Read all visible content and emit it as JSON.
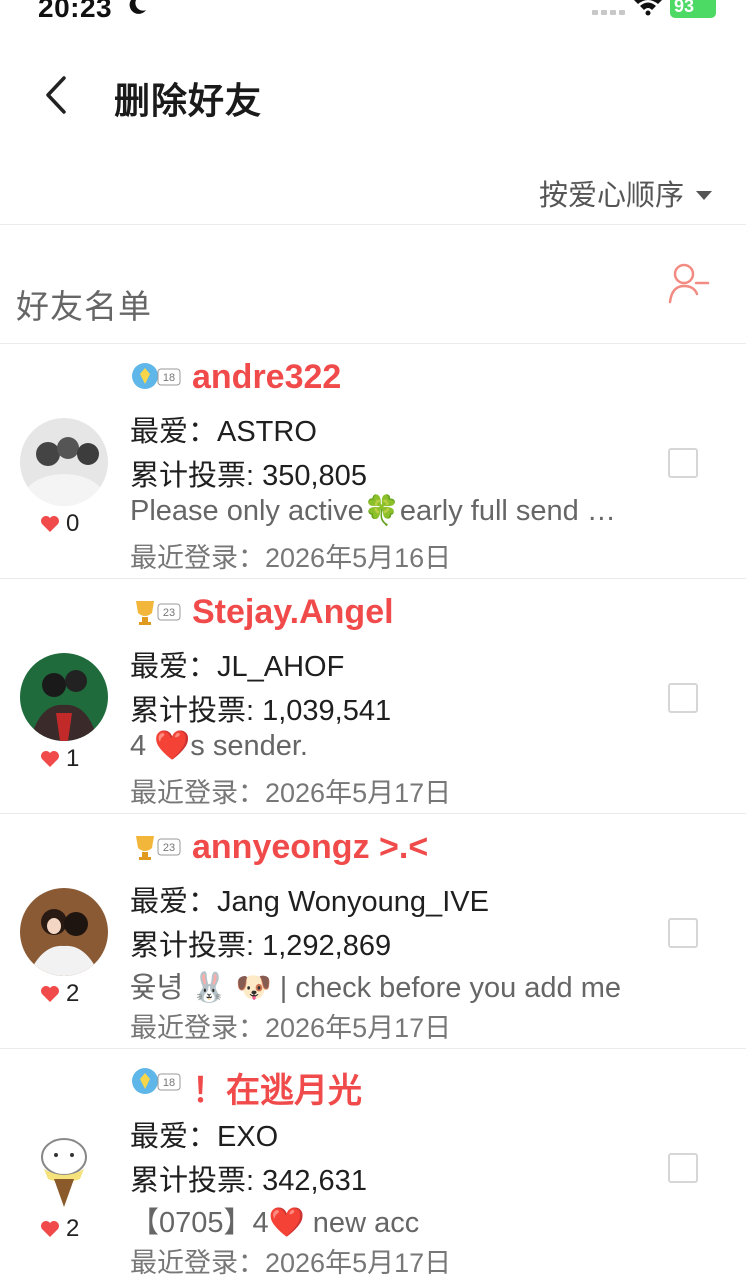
{
  "status_bar": {
    "time": "20:23",
    "battery": "93"
  },
  "header": {
    "title": "删除好友",
    "back_icon": "chevron-left-icon"
  },
  "sort": {
    "label": "按爱心顺序"
  },
  "section": {
    "title": "好友名单",
    "action_icon": "remove-user-icon"
  },
  "colors": {
    "accent": "#f04a4a",
    "battery": "#4cd964"
  },
  "friends": [
    {
      "badge_level": "18",
      "nickname": "andre322",
      "favorite": "最爱：ASTRO",
      "votes": "累计投票: 350,805",
      "bio": "Please only active🍀early full send gifts",
      "login": "最近登录：2026年5月16日",
      "hearts": "0"
    },
    {
      "badge_level": "23",
      "nickname": "Stejay.Angel",
      "favorite": "最爱：JL_AHOF",
      "votes": "累计投票: 1,039,541",
      "bio": "4 ❤️s sender.",
      "login": "最近登录：2026年5月17日",
      "hearts": "1"
    },
    {
      "badge_level": "23",
      "nickname": "annyeongz >.<",
      "favorite": "最爱：Jang Wonyoung_IVE",
      "votes": "累计投票: 1,292,869",
      "bio": "윶녕 🐰 🐶 | check before you add me",
      "login": "最近登录：2026年5月17日",
      "hearts": "2"
    },
    {
      "badge_level": "18",
      "nickname": "！在逃月光",
      "favorite": "最爱：EXO",
      "votes": "累计投票: 342,631",
      "bio": "【0705】4❤️ new acc",
      "login": "最近登录：2026年5月17日",
      "hearts": "2"
    }
  ]
}
